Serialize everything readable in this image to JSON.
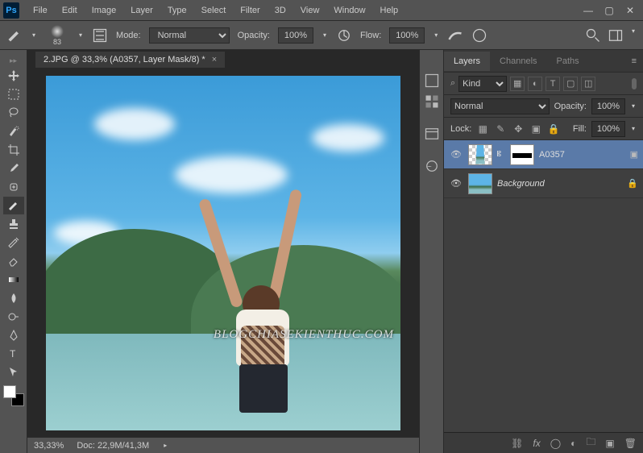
{
  "app": {
    "logo": "Ps"
  },
  "menu": [
    "File",
    "Edit",
    "Image",
    "Layer",
    "Type",
    "Select",
    "Filter",
    "3D",
    "View",
    "Window",
    "Help"
  ],
  "options": {
    "brush_size": "83",
    "mode_label": "Mode:",
    "mode_value": "Normal",
    "opacity_label": "Opacity:",
    "opacity_value": "100%",
    "flow_label": "Flow:",
    "flow_value": "100%"
  },
  "document": {
    "tab_title": "2.JPG @ 33,3% (A0357, Layer Mask/8) *",
    "zoom": "33,33%",
    "doc_label": "Doc:",
    "doc_size": "22,9M/41,3M",
    "watermark": "BLOGCHIASEKIENTHUC.COM"
  },
  "panels": {
    "tabs": [
      "Layers",
      "Channels",
      "Paths"
    ],
    "active_tab": "Layers",
    "filter_kind": "Kind",
    "blend_mode": "Normal",
    "opacity_label": "Opacity:",
    "opacity_value": "100%",
    "lock_label": "Lock:",
    "fill_label": "Fill:",
    "fill_value": "100%",
    "layers": [
      {
        "name": "A0357",
        "selected": true,
        "has_mask": true,
        "locked": false
      },
      {
        "name": "Background",
        "selected": false,
        "has_mask": false,
        "locked": true,
        "italic": true
      }
    ]
  }
}
